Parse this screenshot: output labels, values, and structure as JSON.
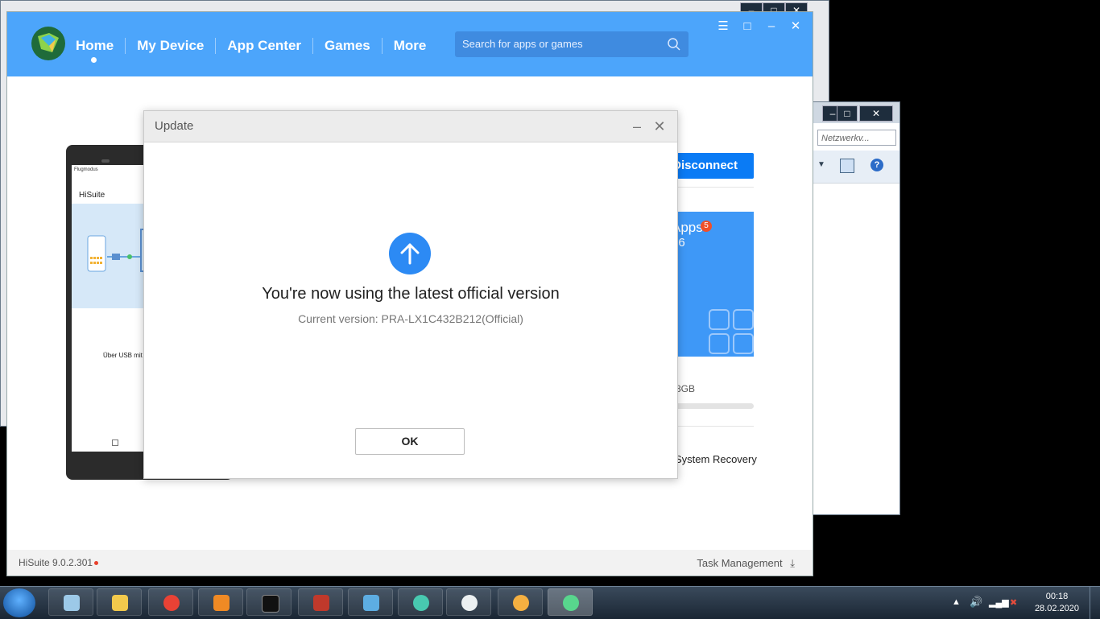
{
  "header": {
    "nav": [
      {
        "label": "Home"
      },
      {
        "label": "My Device"
      },
      {
        "label": "App Center"
      },
      {
        "label": "Games"
      },
      {
        "label": "More"
      }
    ],
    "search_placeholder": "Search for apps or games"
  },
  "device": {
    "status_text": "Flugmodus",
    "app_name": "HiSuite",
    "caption": "Über USB mit"
  },
  "side": {
    "disconnect_label": "Disconnect",
    "apps_label": "Apps",
    "apps_badge": "5",
    "apps_count": "56",
    "storage_text": ".68GB",
    "system_recovery": "System Recovery"
  },
  "footer": {
    "version": "HiSuite 9.0.2.301",
    "task_management": "Task Management"
  },
  "dialog": {
    "title": "Update",
    "headline": "You're now using the latest official version",
    "subtitle": "Current version: PRA-LX1C432B212(Official)",
    "ok_label": "OK"
  },
  "bgwin2": {
    "address_placeholder": "Netzwerkv..."
  },
  "taskbar": {
    "time": "00:18",
    "date": "28.02.2020"
  },
  "colors": {
    "header": "#4ca5fb",
    "accent": "#0a7bf5",
    "dialog_icon": "#2c8af4"
  }
}
